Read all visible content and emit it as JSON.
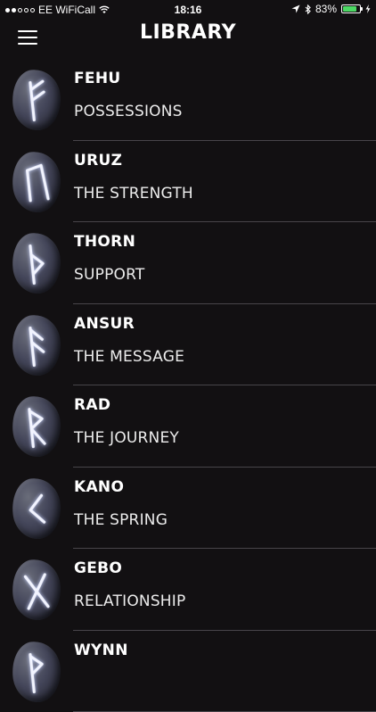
{
  "status_bar": {
    "carrier": "EE WiFiCall",
    "time": "18:16",
    "battery": "83%",
    "battery_level": 0.83
  },
  "nav": {
    "title": "LIBRARY",
    "menu_icon": "hamburger-menu-icon"
  },
  "runes": [
    {
      "name": "FEHU",
      "meaning": "POSSESSIONS",
      "glyph": "fehu"
    },
    {
      "name": "URUZ",
      "meaning": "THE STRENGTH",
      "glyph": "uruz"
    },
    {
      "name": "THORN",
      "meaning": "SUPPORT",
      "glyph": "thorn"
    },
    {
      "name": "ANSUR",
      "meaning": "THE MESSAGE",
      "glyph": "ansur"
    },
    {
      "name": "RAD",
      "meaning": "THE JOURNEY",
      "glyph": "rad"
    },
    {
      "name": "KANO",
      "meaning": "THE SPRING",
      "glyph": "kano"
    },
    {
      "name": "GEBO",
      "meaning": "RELATIONSHIP",
      "glyph": "gebo"
    },
    {
      "name": "WYNN",
      "meaning": "",
      "glyph": "wynn"
    }
  ]
}
